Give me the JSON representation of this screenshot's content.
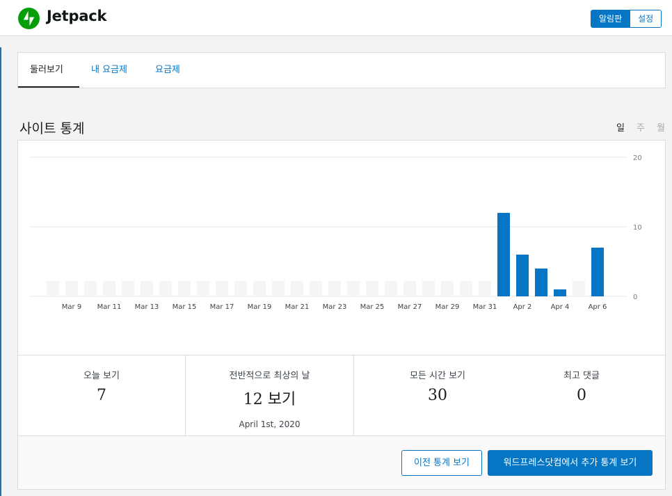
{
  "header": {
    "brand": "Jetpack",
    "toggle": [
      {
        "label": "알림판",
        "active": true
      },
      {
        "label": "설정",
        "active": false
      }
    ]
  },
  "tabs": [
    {
      "label": "둘러보기",
      "active": true
    },
    {
      "label": "내 요금제",
      "active": false
    },
    {
      "label": "요금제",
      "active": false
    }
  ],
  "stats_section": {
    "title": "사이트 통계",
    "periods": [
      {
        "label": "일",
        "active": true
      },
      {
        "label": "주",
        "active": false
      },
      {
        "label": "월",
        "active": false
      }
    ]
  },
  "colors": {
    "accent": "#0675c4",
    "bar": "#0675c4",
    "bar_empty": "#f6f4f6",
    "grid": "#e6e6e6"
  },
  "chart_data": {
    "type": "bar",
    "categories": [
      "Mar 8",
      "Mar 9",
      "Mar 10",
      "Mar 11",
      "Mar 12",
      "Mar 13",
      "Mar 14",
      "Mar 15",
      "Mar 16",
      "Mar 17",
      "Mar 18",
      "Mar 19",
      "Mar 20",
      "Mar 21",
      "Mar 22",
      "Mar 23",
      "Mar 24",
      "Mar 25",
      "Mar 26",
      "Mar 27",
      "Mar 28",
      "Mar 29",
      "Mar 30",
      "Mar 31",
      "Apr 1",
      "Apr 2",
      "Apr 3",
      "Apr 4",
      "Apr 5",
      "Apr 6"
    ],
    "tick_labels": [
      "Mar 9",
      "Mar 11",
      "Mar 13",
      "Mar 15",
      "Mar 17",
      "Mar 19",
      "Mar 21",
      "Mar 23",
      "Mar 25",
      "Mar 27",
      "Mar 29",
      "Mar 31",
      "Apr 2",
      "Apr 4",
      "Apr 6"
    ],
    "values": [
      0,
      0,
      0,
      0,
      0,
      0,
      0,
      0,
      0,
      0,
      0,
      0,
      0,
      0,
      0,
      0,
      0,
      0,
      0,
      0,
      0,
      0,
      0,
      0,
      12,
      6,
      4,
      1,
      0,
      7
    ],
    "yticks": [
      0,
      10,
      20
    ],
    "ylim": [
      0,
      20
    ],
    "grid": true
  },
  "stats": {
    "today": {
      "label": "오늘 보기",
      "value": "7"
    },
    "best_day": {
      "label": "전반적으로 최상의 날",
      "value": "12 보기",
      "date": "April 1st, 2020"
    },
    "all_time": {
      "label": "모든 시간 보기",
      "value": "30"
    },
    "top_comment": {
      "label": "최고 댓글",
      "value": "0"
    }
  },
  "buttons": {
    "older_stats": "이전 통계 보기",
    "more_stats": "워드프레스닷컴에서 추가 통계 보기"
  }
}
